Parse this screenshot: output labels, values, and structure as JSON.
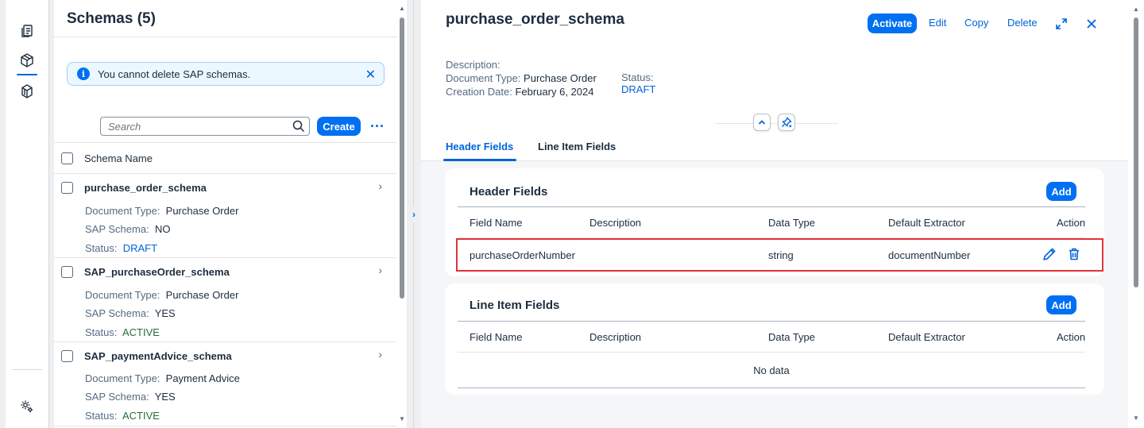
{
  "sidenav": {
    "items": [
      {
        "name": "documents-icon"
      },
      {
        "name": "schemas-icon"
      },
      {
        "name": "templates-icon"
      },
      {
        "name": "settings-icon"
      }
    ]
  },
  "list": {
    "title": "Schemas (5)",
    "message": "You cannot delete SAP schemas.",
    "search_placeholder": "Search",
    "create_label": "Create",
    "more_label": "...",
    "column_header": "Schema Name",
    "labels": {
      "doc_type": "Document Type:",
      "sap_schema": "SAP Schema:",
      "status": "Status:"
    },
    "items": [
      {
        "name": "purchase_order_schema",
        "doc_type": "Purchase Order",
        "sap_schema": "NO",
        "status": "DRAFT"
      },
      {
        "name": "SAP_purchaseOrder_schema",
        "doc_type": "Purchase Order",
        "sap_schema": "YES",
        "status": "ACTIVE"
      },
      {
        "name": "SAP_paymentAdvice_schema",
        "doc_type": "Payment Advice",
        "sap_schema": "YES",
        "status": "ACTIVE"
      }
    ]
  },
  "detail": {
    "title": "purchase_order_schema",
    "actions": {
      "activate": "Activate",
      "edit": "Edit",
      "copy": "Copy",
      "delete": "Delete"
    },
    "meta": {
      "description_label": "Description:",
      "doc_type_label": "Document Type:",
      "doc_type_value": "Purchase Order",
      "creation_label": "Creation Date:",
      "creation_value": "February 6, 2024",
      "status_label": "Status:",
      "status_value": "DRAFT"
    },
    "tabs": [
      {
        "label": "Header Fields",
        "active": true
      },
      {
        "label": "Line Item Fields",
        "active": false
      }
    ],
    "header_fields": {
      "title": "Header Fields",
      "add_label": "Add",
      "columns": [
        "Field Name",
        "Description",
        "Data Type",
        "Default Extractor",
        "Action"
      ],
      "rows": [
        {
          "field_name": "purchaseOrderNumber",
          "description": "",
          "data_type": "string",
          "default_extractor": "documentNumber"
        }
      ]
    },
    "line_item_fields": {
      "title": "Line Item Fields",
      "add_label": "Add",
      "columns": [
        "Field Name",
        "Description",
        "Data Type",
        "Default Extractor",
        "Action"
      ],
      "empty_text": "No data"
    }
  },
  "colors": {
    "accent": "#0070f2",
    "link": "#0064d9",
    "draft": "#0064d9",
    "active": "#256f3a",
    "highlight": "#e0333a"
  }
}
